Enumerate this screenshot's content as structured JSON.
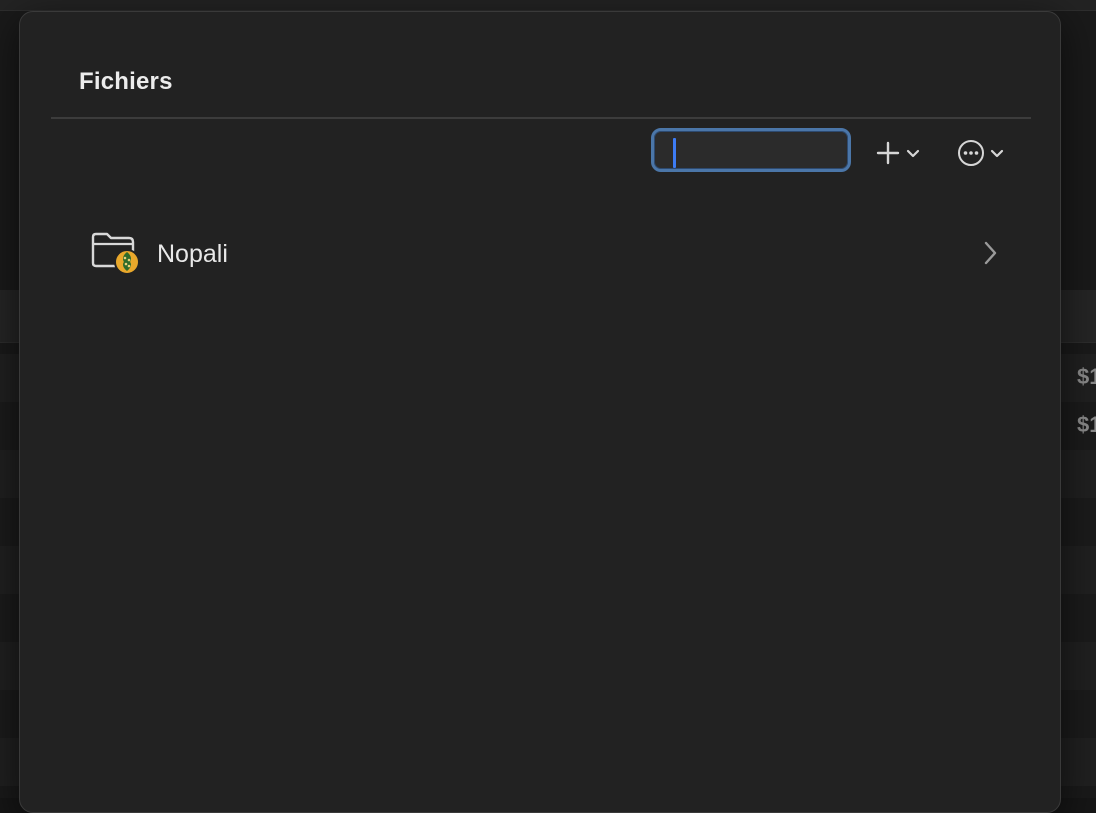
{
  "panel": {
    "title": "Fichiers"
  },
  "toolbar": {
    "search_value": "",
    "search_placeholder": "",
    "add_icon": "plus-icon",
    "add_menu_icon": "chevron-down-icon",
    "more_icon": "ellipsis-circle-icon",
    "more_menu_icon": "chevron-down-icon"
  },
  "files": [
    {
      "name": "Nopali",
      "icon": "folder-with-badge-icon",
      "disclosure_icon": "chevron-right-icon"
    }
  ],
  "background": {
    "price_fragments": [
      "$1",
      "$1"
    ]
  },
  "colors": {
    "panel_bg": "#222222",
    "focus_ring": "#4b76a8",
    "caret": "#3d7cf5",
    "badge": "#e9a82b"
  }
}
